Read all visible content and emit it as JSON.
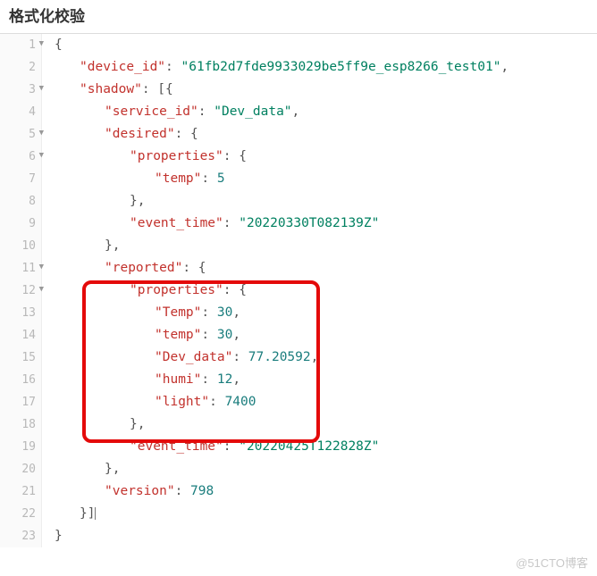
{
  "title": "格式化校验",
  "watermark": "@51CTO博客",
  "highlight_box": {
    "top_line": 12,
    "bottom_line": 18
  },
  "gutter_lines": 23,
  "json": {
    "device_id": "61fb2d7fde9933029be5ff9e_esp8266_test01",
    "shadow": [
      {
        "service_id": "Dev_data",
        "desired": {
          "properties": {
            "temp": 5
          },
          "event_time": "20220330T082139Z"
        },
        "reported": {
          "properties": {
            "Temp": 30,
            "temp": 30,
            "Dev_data": 77.20592,
            "humi": 12,
            "light": 7400
          },
          "event_time": "20220425T122828Z"
        },
        "version": 798
      }
    ]
  },
  "labels": {
    "device_id_key": "\"device_id\"",
    "device_id_val": "\"61fb2d7fde9933029be5ff9e_esp8266_test01\"",
    "shadow_key": "\"shadow\"",
    "service_id_key": "\"service_id\"",
    "service_id_val": "\"Dev_data\"",
    "desired_key": "\"desired\"",
    "properties_key": "\"properties\"",
    "temp_key": "\"temp\"",
    "temp_val_5": "5",
    "event_time_key": "\"event_time\"",
    "event_time_1": "\"20220330T082139Z\"",
    "reported_key": "\"reported\"",
    "Temp_key": "\"Temp\"",
    "Temp_val": "30",
    "temp_val_30": "30",
    "Dev_data_key": "\"Dev_data\"",
    "Dev_data_val": "77.20592",
    "humi_key": "\"humi\"",
    "humi_val": "12",
    "light_key": "\"light\"",
    "light_val": "7400",
    "event_time_2": "\"20220425T122828Z\"",
    "version_key": "\"version\"",
    "version_val": "798"
  }
}
